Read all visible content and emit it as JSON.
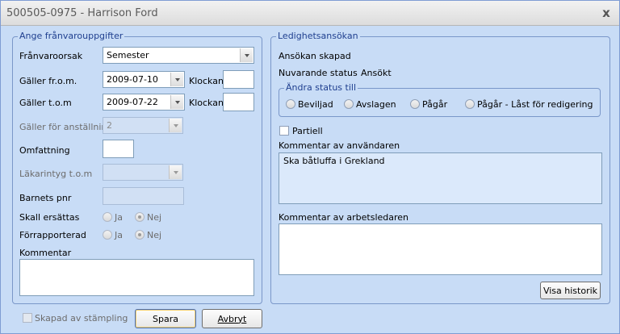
{
  "window": {
    "title": "500505-0975 - Harrison Ford",
    "close_glyph": "x"
  },
  "left_group": {
    "legend": "Ange frånvarouppgifter",
    "franvaroorsak": {
      "label": "Frånvaroorsak",
      "value": "Semester"
    },
    "galler_from": {
      "label": "Gäller fr.o.m.",
      "value": "2009-07-10",
      "time_label": "Klockan",
      "time_value": ""
    },
    "galler_tom": {
      "label": "Gäller t.o.m",
      "value": "2009-07-22",
      "time_label": "Klockan",
      "time_value": ""
    },
    "anstallning": {
      "label": "Gäller för anställning",
      "value": "2"
    },
    "omfattning": {
      "label": "Omfattning",
      "value": ""
    },
    "lakarintyg": {
      "label": "Läkarintyg t.o.m",
      "value": ""
    },
    "barnets_pnr": {
      "label": "Barnets pnr",
      "value": ""
    },
    "skall_ersattas": {
      "label": "Skall ersättas",
      "option_ja": "Ja",
      "option_nej": "Nej",
      "selected": "Nej"
    },
    "forrapporterad": {
      "label": "Förrapporterad",
      "option_ja": "Ja",
      "option_nej": "Nej",
      "selected": "Nej"
    },
    "kommentar": {
      "label": "Kommentar",
      "value": ""
    }
  },
  "right_group": {
    "legend": "Ledighetsansökan",
    "ansokan_skapad": "Ansökan skapad",
    "nuvarande_status_label": "Nuvarande status",
    "nuvarande_status_value": "Ansökt",
    "andra_status": {
      "legend": "Ändra status till",
      "options": [
        "Beviljad",
        "Avslagen",
        "Pågår",
        "Pågår - Låst för redigering"
      ]
    },
    "partiell": "Partiell",
    "kommentar_anvandaren": {
      "label": "Kommentar av användaren",
      "value": "Ska båtluffa i Grekland"
    },
    "kommentar_arbetsledaren": {
      "label": "Kommentar av arbetsledaren",
      "value": ""
    },
    "visa_historik": "Visa historik"
  },
  "footer": {
    "skapad_av_stampling": "Skapad av stämpling",
    "spara": "Spara",
    "avbryt": "Avbryt"
  },
  "colors": {
    "window_bg": "#c8dcf6",
    "legend_text": "#1f3f8f",
    "group_border": "#7a97c9"
  }
}
